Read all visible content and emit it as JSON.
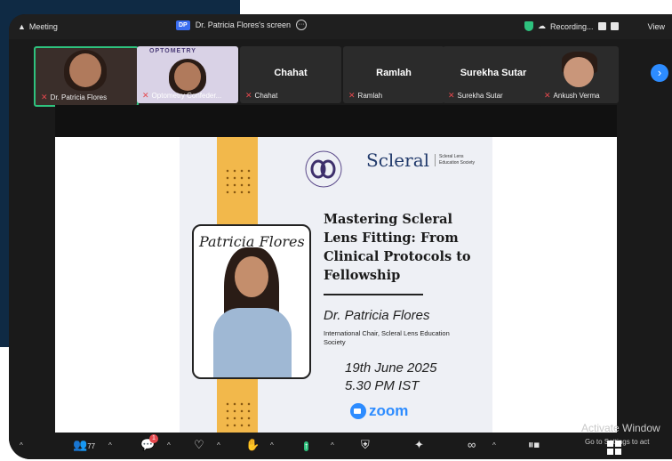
{
  "titlebar": {
    "meeting_label": "Meeting",
    "share_badge": "DP",
    "share_label": "Dr. Patricia Flores's screen",
    "recording_label": "Recording...",
    "view_label": "View"
  },
  "participants": [
    {
      "name": "Dr. Patricia Flores",
      "display": ""
    },
    {
      "name": "Optometry Confeder...",
      "display": ""
    },
    {
      "name": "Chahat",
      "display": "Chahat"
    },
    {
      "name": "Ramlah",
      "display": "Ramlah"
    },
    {
      "name": "Surekha Sutar",
      "display": "Surekha Sutar"
    },
    {
      "name": "Ankush Verma",
      "display": ""
    }
  ],
  "slide": {
    "occ_top": "OPTOMETRY",
    "occ_mark": "OCI",
    "scleral_logo": "Scleral",
    "scleral_sub": "Scleral Lens Education Society",
    "signature": "Patricia Flores",
    "title": "Mastering Scleral Lens Fitting: From Clinical Protocols to Fellowship",
    "presenter": "Dr. Patricia Flores",
    "role": "International Chair, Scleral Lens Education Society",
    "date": "19th June 2025",
    "time": "5.30 PM IST",
    "zoom_word": "zoom"
  },
  "toolbar": {
    "participants_count": "77",
    "chat_badge": "1"
  },
  "watermark": {
    "line1": "Activate Window",
    "line2": "Go to Settings to act"
  },
  "colors": {
    "accent_blue": "#2d8cff",
    "stripe_orange": "#f2b84b",
    "record_green": "#2ec27e"
  }
}
